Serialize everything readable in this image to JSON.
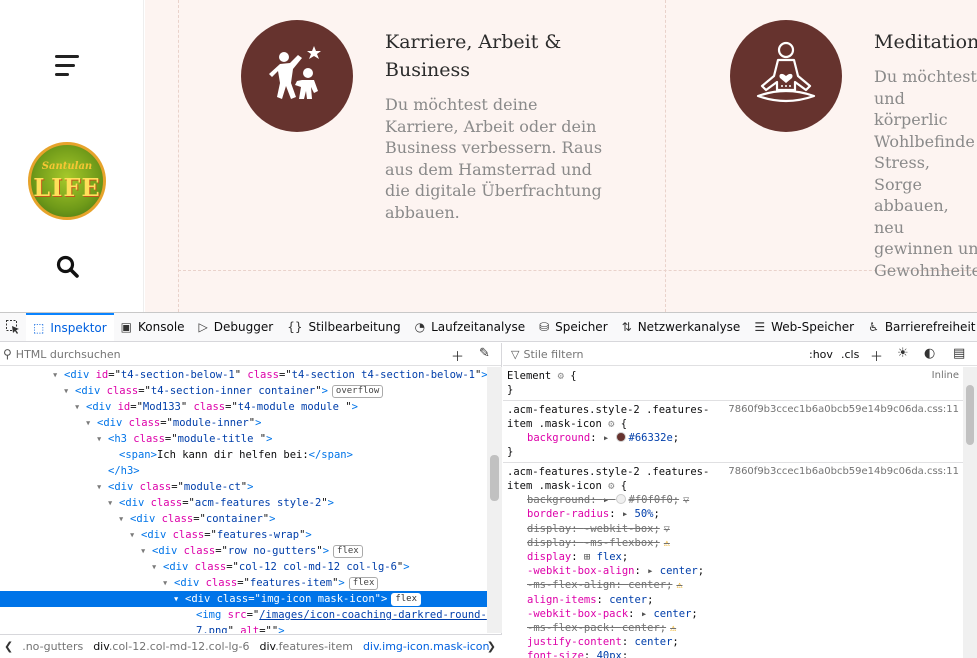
{
  "site": {
    "features": [
      {
        "icon": "career-icon",
        "title_line1": "Karriere, Arbeit &",
        "title_line2": "Business",
        "text": "Du möchtest deine\nKarriere, Arbeit oder dein\nBusiness verbessern. Raus\naus dem Hamsterrad und\ndie digitale Überfrachtung\nabbauen."
      },
      {
        "icon": "meditation-icon",
        "title_line1": "Meditation",
        "title_line2": "",
        "text": "Du möchtest\nund körperlic\nWohlbefinde\nStress, Sorge\nabbauen, neu\ngewinnen un\nGewohnheite"
      }
    ],
    "logo_top": "Santulan",
    "logo_main": "LIFE"
  },
  "devtools": {
    "tabs": [
      "Inspektor",
      "Konsole",
      "Debugger",
      "Stilbearbeitung",
      "Laufzeitanalyse",
      "Speicher",
      "Netzwerkanalyse",
      "Web-Speicher",
      "Barrierefreiheit"
    ],
    "html_search_placeholder": "HTML durchsuchen",
    "style_filter_placeholder": "Stile filtern",
    "hov": ":hov",
    "cls": ".cls",
    "markup": [
      {
        "indent": 64,
        "arrow": "▾",
        "parts": [
          [
            "tag",
            "<div "
          ],
          [
            "an",
            "id"
          ],
          [
            "pl",
            "=\""
          ],
          [
            "av",
            "t4-section-below-1"
          ],
          [
            "pl",
            "\" "
          ],
          [
            "an",
            "class"
          ],
          [
            "pl",
            "=\""
          ],
          [
            "av",
            "t4-section t4-section-below-1"
          ],
          [
            "pl",
            "\""
          ],
          [
            "tag",
            ">"
          ]
        ]
      },
      {
        "indent": 75,
        "arrow": "▾",
        "parts": [
          [
            "tag",
            "<div "
          ],
          [
            "an",
            "class"
          ],
          [
            "pl",
            "=\""
          ],
          [
            "av",
            "t4-section-inner container"
          ],
          [
            "pl",
            "\""
          ],
          [
            "tag",
            ">"
          ]
        ],
        "badge": "overflow"
      },
      {
        "indent": 86,
        "arrow": "▾",
        "parts": [
          [
            "tag",
            "<div "
          ],
          [
            "an",
            "id"
          ],
          [
            "pl",
            "=\""
          ],
          [
            "av",
            "Mod133"
          ],
          [
            "pl",
            "\" "
          ],
          [
            "an",
            "class"
          ],
          [
            "pl",
            "=\""
          ],
          [
            "av",
            "t4-module module "
          ],
          [
            "pl",
            "\""
          ],
          [
            "tag",
            ">"
          ]
        ]
      },
      {
        "indent": 97,
        "arrow": "▾",
        "parts": [
          [
            "tag",
            "<div "
          ],
          [
            "an",
            "class"
          ],
          [
            "pl",
            "=\""
          ],
          [
            "av",
            "module-inner"
          ],
          [
            "pl",
            "\""
          ],
          [
            "tag",
            ">"
          ]
        ]
      },
      {
        "indent": 108,
        "arrow": "▾",
        "parts": [
          [
            "tag",
            "<h3 "
          ],
          [
            "an",
            "class"
          ],
          [
            "pl",
            "=\""
          ],
          [
            "av",
            "module-title "
          ],
          [
            "pl",
            "\""
          ],
          [
            "tag",
            ">"
          ]
        ]
      },
      {
        "indent": 119,
        "arrow": "",
        "parts": [
          [
            "tag",
            "<span>"
          ],
          [
            "pl",
            "Ich kann dir helfen bei:"
          ],
          [
            "tag",
            "</span>"
          ]
        ]
      },
      {
        "indent": 108,
        "arrow": "",
        "parts": [
          [
            "tag",
            "</h3>"
          ]
        ]
      },
      {
        "indent": 108,
        "arrow": "▾",
        "parts": [
          [
            "tag",
            "<div "
          ],
          [
            "an",
            "class"
          ],
          [
            "pl",
            "=\""
          ],
          [
            "av",
            "module-ct"
          ],
          [
            "pl",
            "\""
          ],
          [
            "tag",
            ">"
          ]
        ]
      },
      {
        "indent": 119,
        "arrow": "▾",
        "parts": [
          [
            "tag",
            "<div "
          ],
          [
            "an",
            "class"
          ],
          [
            "pl",
            "=\""
          ],
          [
            "av",
            "acm-features style-2"
          ],
          [
            "pl",
            "\""
          ],
          [
            "tag",
            ">"
          ]
        ]
      },
      {
        "indent": 130,
        "arrow": "▾",
        "parts": [
          [
            "tag",
            "<div "
          ],
          [
            "an",
            "class"
          ],
          [
            "pl",
            "=\""
          ],
          [
            "av",
            "container"
          ],
          [
            "pl",
            "\""
          ],
          [
            "tag",
            ">"
          ]
        ]
      },
      {
        "indent": 141,
        "arrow": "▾",
        "parts": [
          [
            "tag",
            "<div "
          ],
          [
            "an",
            "class"
          ],
          [
            "pl",
            "=\""
          ],
          [
            "av",
            "features-wrap"
          ],
          [
            "pl",
            "\""
          ],
          [
            "tag",
            ">"
          ]
        ]
      },
      {
        "indent": 152,
        "arrow": "▾",
        "parts": [
          [
            "tag",
            "<div "
          ],
          [
            "an",
            "class"
          ],
          [
            "pl",
            "=\""
          ],
          [
            "av",
            "row no-gutters"
          ],
          [
            "pl",
            "\""
          ],
          [
            "tag",
            ">"
          ]
        ],
        "badge": "flex"
      },
      {
        "indent": 163,
        "arrow": "▾",
        "parts": [
          [
            "tag",
            "<div "
          ],
          [
            "an",
            "class"
          ],
          [
            "pl",
            "=\""
          ],
          [
            "av",
            "col-12 col-md-12 col-lg-6"
          ],
          [
            "pl",
            "\""
          ],
          [
            "tag",
            ">"
          ]
        ]
      },
      {
        "indent": 174,
        "arrow": "▾",
        "parts": [
          [
            "tag",
            "<div "
          ],
          [
            "an",
            "class"
          ],
          [
            "pl",
            "=\""
          ],
          [
            "av",
            "features-item"
          ],
          [
            "pl",
            "\""
          ],
          [
            "tag",
            ">"
          ]
        ],
        "badge": "flex"
      },
      {
        "indent": 185,
        "arrow": "▾",
        "selected": true,
        "parts": [
          [
            "tag",
            "<div "
          ],
          [
            "an",
            "class"
          ],
          [
            "pl",
            "=\""
          ],
          [
            "av",
            "img-icon mask-icon"
          ],
          [
            "pl",
            "\""
          ],
          [
            "tag",
            ">"
          ]
        ],
        "badge": "flex"
      },
      {
        "indent": 196,
        "arrow": "",
        "parts": [
          [
            "tag",
            "<img "
          ],
          [
            "an",
            "src"
          ],
          [
            "pl",
            "=\""
          ],
          [
            "lnk",
            "/images/icon-coaching-darkred-round-"
          ],
          [
            "pl",
            ""
          ]
        ]
      },
      {
        "indent": 196,
        "arrow": "",
        "parts": [
          [
            "lnk",
            "7.png"
          ],
          [
            "pl",
            "\" "
          ],
          [
            "an",
            "alt"
          ],
          [
            "pl",
            "=\"\""
          ],
          [
            "tag",
            ">"
          ]
        ]
      }
    ],
    "breadcrumbs": [
      {
        "tag": "",
        "cls": ".no-gutters",
        "current": false
      },
      {
        "tag": "div",
        "cls": ".col-12.col-md-12.col-lg-6",
        "current": false
      },
      {
        "tag": "div",
        "cls": ".features-item",
        "current": false
      },
      {
        "tag": "div",
        "cls": ".img-icon.mask-icon",
        "current": true
      }
    ],
    "rules": {
      "element_label": "Element",
      "inline_label": "Inline",
      "r1_selector_1": ".acm-features.style-2 .features-",
      "r1_selector_2": "item .mask-icon",
      "r1_source": "7860f9b3ccec1b6a0bcb59e14b9c06da.css:11",
      "r1_bg_name": "background",
      "r1_bg_value": "#66332e",
      "r2_selector_1": ".acm-features.style-2 .features-",
      "r2_selector_2": "item .mask-icon",
      "r2_source": "7860f9b3ccec1b6a0bcb59e14b9c06da.css:11",
      "decls": [
        {
          "name": "background",
          "value": "#f0f0f0",
          "struck": true,
          "swatch": "#f0f0f0",
          "flag": "filter"
        },
        {
          "name": "border-radius",
          "value": "50%",
          "struck": false,
          "arrow": true
        },
        {
          "name": "display",
          "value": "-webkit-box",
          "struck": true,
          "flag": "filter"
        },
        {
          "name": "display",
          "value": "-ms-flexbox",
          "struck": true,
          "flag": "warn"
        },
        {
          "name": "display",
          "value": "flex",
          "struck": false,
          "grid": true
        },
        {
          "name": "-webkit-box-align",
          "value": "center",
          "struck": false,
          "arrow": true
        },
        {
          "name": "-ms-flex-align",
          "value": "center",
          "struck": true,
          "flag": "warn"
        },
        {
          "name": "align-items",
          "value": "center",
          "struck": false
        },
        {
          "name": "-webkit-box-pack",
          "value": "center",
          "struck": false,
          "arrow": true
        },
        {
          "name": "-ms-flex-pack",
          "value": "center",
          "struck": true,
          "flag": "warn"
        },
        {
          "name": "justify-content",
          "value": "center",
          "struck": false
        },
        {
          "name": "font-size",
          "value": "40px",
          "struck": false
        }
      ]
    }
  },
  "colors": {
    "brand": "#66332e",
    "accent": "#0a84ff",
    "selected": "#0074e8"
  }
}
